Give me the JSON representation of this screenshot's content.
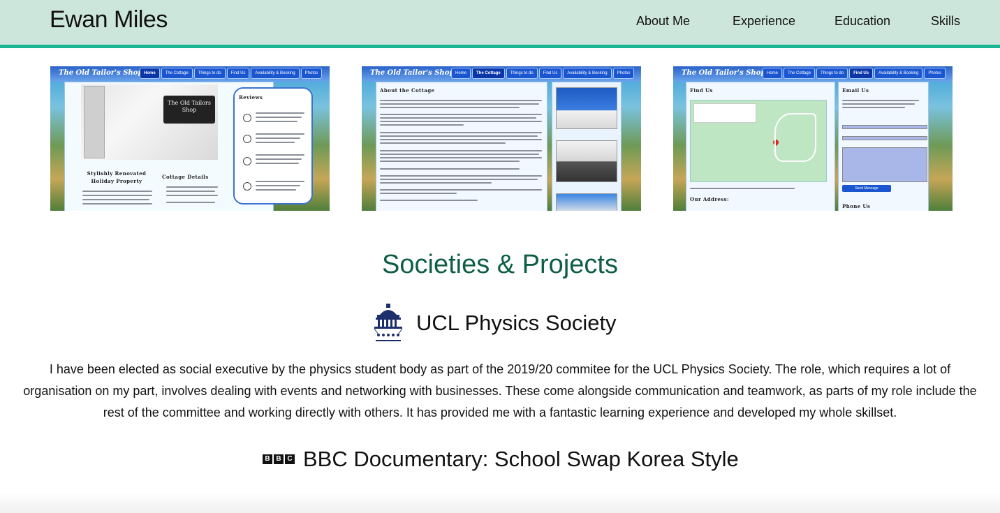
{
  "header": {
    "brand": "Ewan Miles",
    "nav": [
      "About Me",
      "Experience",
      "Education",
      "Skills"
    ]
  },
  "screenshots": [
    {
      "site_name": "The Old Tailor's Shop",
      "tabs": [
        "Home",
        "The Cottage",
        "Things to do",
        "Find Us",
        "Availability & Booking",
        "Photos"
      ],
      "active_tab": "Home",
      "sign_text": "The Old Tailors Shop",
      "left_heading": "Stylishly Renovated Holiday Property",
      "mid_heading": "Cottage Details",
      "right_heading": "Reviews"
    },
    {
      "site_name": "The Old Tailor's Shop",
      "tabs": [
        "Home",
        "The Cottage",
        "Things to do",
        "Find Us",
        "Availability & Booking",
        "Photos"
      ],
      "active_tab": "The Cottage",
      "left_heading": "About the Cottage"
    },
    {
      "site_name": "The Old Tailor's Shop",
      "tabs": [
        "Home",
        "The Cottage",
        "Things to do",
        "Find Us",
        "Availability & Booking",
        "Photos"
      ],
      "active_tab": "Find Us",
      "left_heading": "Find Us",
      "right_heading": "Email Us",
      "address_heading": "Our Address:",
      "phone_heading": "Phone Us",
      "send_button": "Send Message"
    }
  ],
  "section": {
    "title": "Societies & Projects",
    "society_name": "UCL Physics Society",
    "society_description": "I have been elected as social executive by the physics student body as part of the 2019/20 commitee for the UCL Physics Society. The role, which requires a lot of organisation on my part, involves dealing with events and networking with businesses. These come alongside communication and teamwork, as parts of my role include the rest of the committee and working directly with others. It has provided me with a fantastic learning experience and developed my whole skillset.",
    "bbc_logo": [
      "B",
      "B",
      "C"
    ],
    "bbc_title": "BBC Documentary: School Swap Korea Style"
  },
  "colors": {
    "header_bg": "#cde6dc",
    "header_line": "#19b592",
    "section_title": "#0d5e44"
  }
}
